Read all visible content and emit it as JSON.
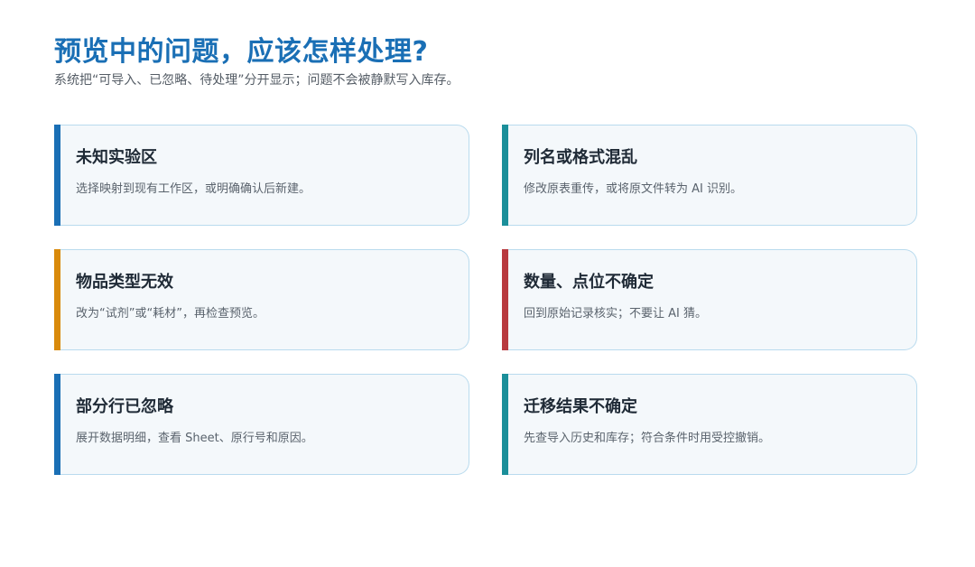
{
  "header": {
    "title": "预览中的问题，应该怎样处理?",
    "subtitle": "系统把“可导入、已忽略、待处理”分开显示；问题不会被静默写入库存。"
  },
  "colors": {
    "title": "#1a6fb5",
    "bar_blue": "#1a6fb5",
    "bar_teal": "#1b8f9a",
    "bar_orange": "#d98a0b",
    "bar_red": "#b83a3f",
    "card_bg": "#f4f8fb",
    "card_border": "#b9dbee"
  },
  "cards": [
    {
      "title": "未知实验区",
      "desc": "选择映射到现有工作区，或明确确认后新建。",
      "accent": "#1a6fb5"
    },
    {
      "title": "列名或格式混乱",
      "desc": "修改原表重传，或将原文件转为 AI 识别。",
      "accent": "#1b8f9a"
    },
    {
      "title": "物品类型无效",
      "desc": "改为“试剂”或“耗材”，再检查预览。",
      "accent": "#d98a0b"
    },
    {
      "title": "数量、点位不确定",
      "desc": "回到原始记录核实；不要让 AI 猜。",
      "accent": "#b83a3f"
    },
    {
      "title": "部分行已忽略",
      "desc": "展开数据明细，查看 Sheet、原行号和原因。",
      "accent": "#1a6fb5"
    },
    {
      "title": "迁移结果不确定",
      "desc": "先查导入历史和库存；符合条件时用受控撤销。",
      "accent": "#1b8f9a"
    }
  ]
}
